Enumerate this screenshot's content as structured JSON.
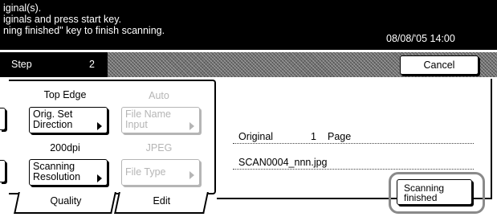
{
  "header": {
    "line1": "iginal(s).",
    "line2": "iginals and press start key.",
    "line3": "ning finished\" key to finish scanning.",
    "datetime": "08/08/'05 14:00"
  },
  "stepbar": {
    "label": "Step",
    "number": "2",
    "cancel_label": "Cancel"
  },
  "panel": {
    "col1_top_label": "Top Edge",
    "col2_top_label": "Auto",
    "orig_set_direction": {
      "line1": "Orig. Set",
      "line2": "Direction"
    },
    "file_name_input": {
      "line1": "File Name",
      "line2": "Input"
    },
    "col1_mid_label": "200dpi",
    "col2_mid_label": "JPEG",
    "scanning_resolution": {
      "line1": "Scanning",
      "line2": "Resolution"
    },
    "file_type": {
      "line1": "File Type"
    }
  },
  "tabs": [
    {
      "label": "Quality"
    },
    {
      "label": "Edit"
    }
  ],
  "info": {
    "original_label": "Original",
    "page_count": "1",
    "page_unit": "Page",
    "filename": "SCAN0004_nnn.jpg"
  },
  "scanning_finished": {
    "line1": "Scanning",
    "line2": "finished"
  },
  "colors": {
    "header_bg": "#000000",
    "disabled_text": "#b5b5b5",
    "highlight_ring": "#8a8a8a"
  }
}
